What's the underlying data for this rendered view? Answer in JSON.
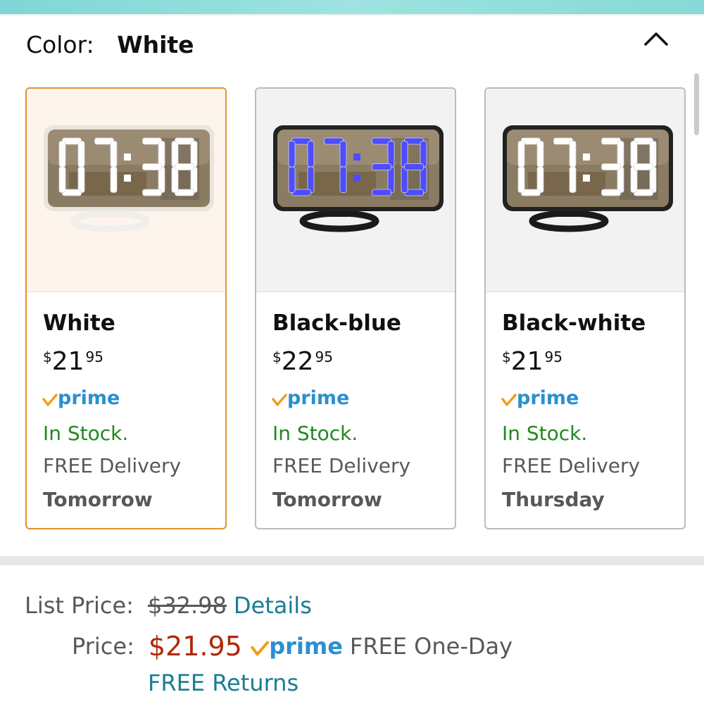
{
  "color": {
    "label": "Color:",
    "selected": "White"
  },
  "variants": [
    {
      "name": "White",
      "price_currency": "$",
      "price_whole": "21",
      "price_fraction": "95",
      "prime": "prime",
      "stock": "In Stock.",
      "delivery": "FREE Delivery",
      "delivery_day": "Tomorrow",
      "digit_color": "#ffffff",
      "base_color": "#ffffff",
      "selected": true
    },
    {
      "name": "Black-blue",
      "price_currency": "$",
      "price_whole": "22",
      "price_fraction": "95",
      "prime": "prime",
      "stock": "In Stock.",
      "delivery": "FREE Delivery",
      "delivery_day": "Tomorrow",
      "digit_color": "#4d4dff",
      "base_color": "#1a1a1a",
      "selected": false
    },
    {
      "name": "Black-white",
      "price_currency": "$",
      "price_whole": "21",
      "price_fraction": "95",
      "prime": "prime",
      "stock": "In Stock.",
      "delivery": "FREE Delivery",
      "delivery_day": "Thursday",
      "digit_color": "#ffffff",
      "base_color": "#1a1a1a",
      "selected": false
    }
  ],
  "clock_display": "07:38",
  "pricing": {
    "list_label": "List Price:",
    "list_value": "$32.98",
    "details_link": "Details",
    "price_label": "Price:",
    "price_value": "$21.95",
    "prime": "prime",
    "shipping": "FREE One-Day",
    "returns_link": "FREE Returns"
  },
  "colors": {
    "selected_border": "#e0922f",
    "price_red": "#b12704",
    "in_stock_green": "#1f8a1f",
    "link_teal": "#1a7c93",
    "prime_blue": "#2b8fd0",
    "prime_check_orange": "#f39c1a"
  },
  "icons": {
    "collapse": "chevron-up-icon",
    "prime_check": "prime-check-icon"
  }
}
